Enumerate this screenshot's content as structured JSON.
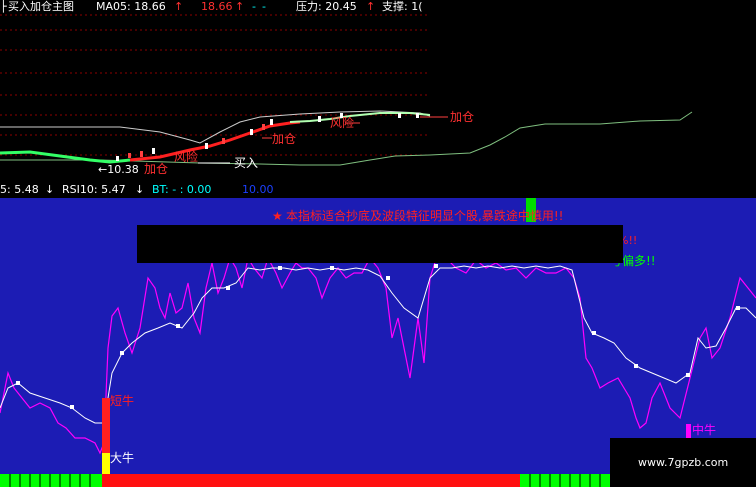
{
  "top_panel": {
    "title": "买入加仓主图",
    "ma_label": "MA05: 18.66",
    "ma_arrow": "↑",
    "ma_value2": "18.66",
    "ma_arrow2": "↑",
    "minus1": "-",
    "minus2": "-",
    "pressure": "压力: 20.45",
    "pressure_arrow": "↑",
    "support": "支撑: 1(",
    "left_marker": "├",
    "labels": {
      "jiacang_right": "加仓",
      "fengxian_mid": "风险",
      "jiacang_mid": "加仓",
      "fengxian_left": "风险",
      "jiacang_left": "加仓",
      "mairu": "买入",
      "price_low": "←10.38"
    }
  },
  "mid_bar": {
    "rsi5": "5: 5.48",
    "rsi5_arrow": "↓",
    "rsi10": "RSI10: 5.47",
    "rsi10_arrow": "↓",
    "bt": "BT: - : 0.00",
    "bt2": "10.00"
  },
  "bottom_panel": {
    "notice_star": "★",
    "notice": "本指标适合抄底及波段特征明显个股,暴跌途中慎用!!",
    "notice2_tail": "%!!",
    "notice3_tail": "号偏多!!",
    "labels": {
      "duanniu": "短牛",
      "daniu": "大牛",
      "zhongniu": "中牛"
    },
    "watermark": "www.7gpzb.com"
  },
  "colors": {
    "bg_top": "#000000",
    "bg_bottom": "#1c1cb4",
    "red": "#ff3030",
    "green": "#00ff00",
    "yellow": "#ffff00",
    "magenta": "#ff00ff",
    "white": "#ffffff",
    "grid_red": "#8b0000"
  }
}
